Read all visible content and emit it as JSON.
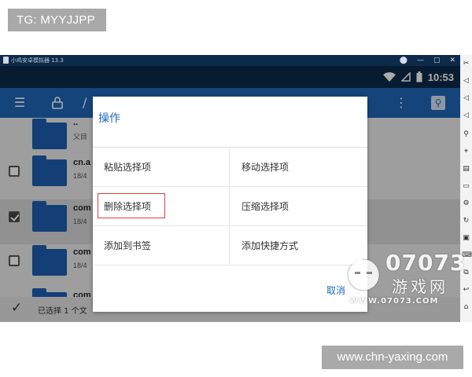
{
  "overlay": {
    "top_left_badge": "TG: MYYJJPP",
    "bottom_right_badge": "www.chn-yaxing.com"
  },
  "emulator": {
    "title": "小鸡安卓模拟器 13.3",
    "window_controls": [
      "⬤",
      "—",
      "▢",
      "✕"
    ],
    "clock": "10:53"
  },
  "file_list": {
    "rows": [
      {
        "name": "..",
        "sub": "父目",
        "checked": null
      },
      {
        "name": "cn.a",
        "sub": "18/4",
        "checked": false
      },
      {
        "name": "com",
        "sub": "18/4",
        "checked": true
      },
      {
        "name": "com",
        "sub": "18/4",
        "checked": false
      },
      {
        "name": "com",
        "sub": "",
        "checked": null
      }
    ],
    "selection_status": "已选择 1 个文"
  },
  "dialog": {
    "title": "操作",
    "options": [
      "粘贴选择项",
      "移动选择项",
      "删除选择项",
      "压缩选择项",
      "添加到书签",
      "添加快捷方式"
    ],
    "cancel": "取消"
  },
  "watermark": {
    "number": "07073",
    "name": "游戏网",
    "domain": "WWW.07073.COM"
  },
  "colors": {
    "appbar": "#1e66b7",
    "dialog_accent": "#1d6bc4",
    "highlight_box": "#d84040",
    "titlebar": "#0d2a4a"
  }
}
